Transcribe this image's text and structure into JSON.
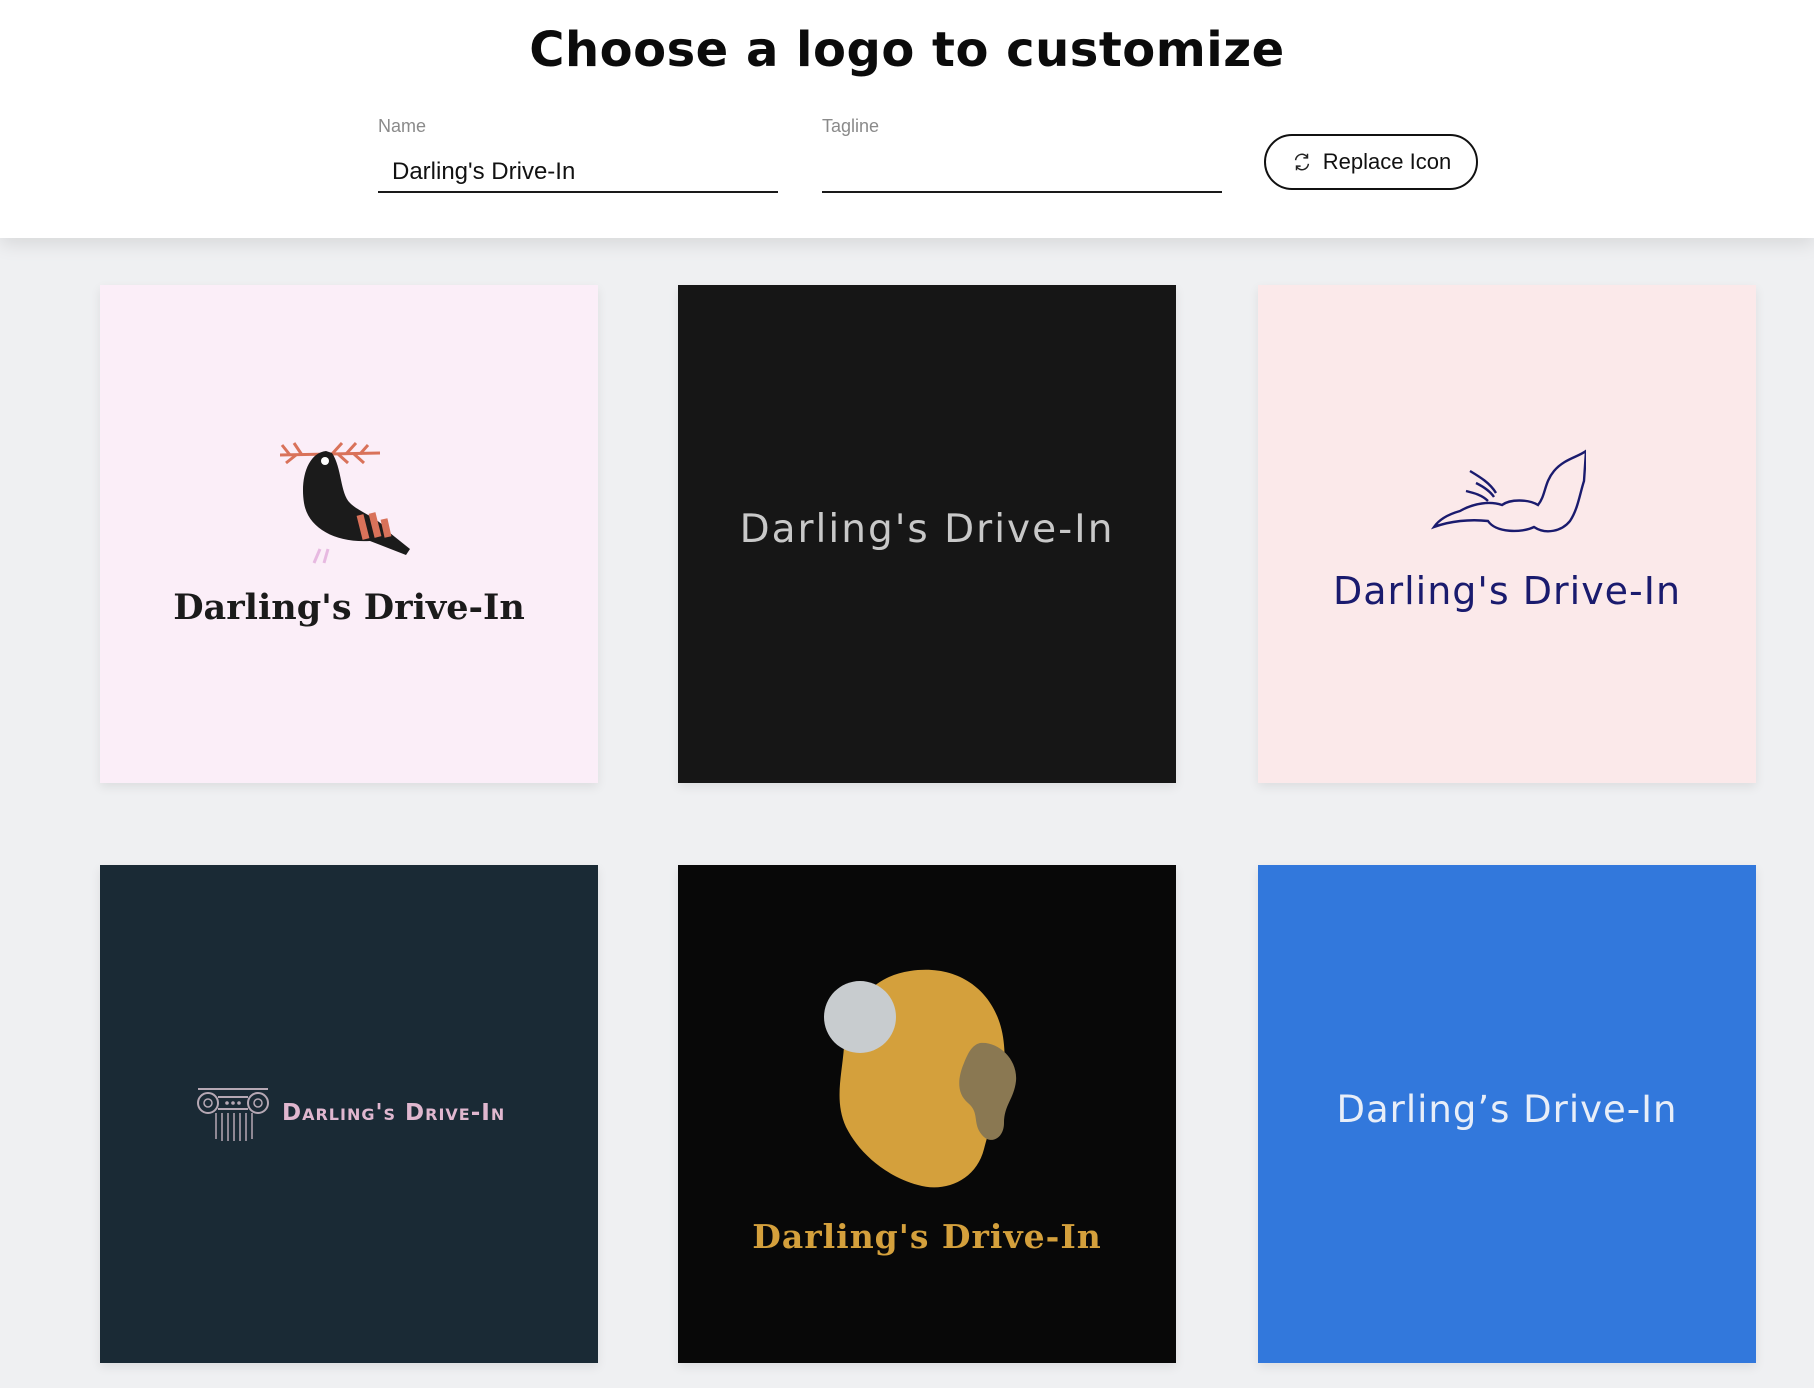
{
  "header": {
    "title": "Choose a logo to customize",
    "name_label": "Name",
    "name_value": "Darling's Drive-In",
    "tagline_label": "Tagline",
    "tagline_value": "",
    "replace_label": "Replace Icon",
    "replace_icon": "swap-arrows-icon"
  },
  "logos": [
    {
      "text": "Darling's Drive-In",
      "icon": "pigeon-with-olive-branch-icon",
      "bg": "#fbeef8",
      "color": "#1b1b1b"
    },
    {
      "text": "Darling's Drive-In",
      "icon": "none",
      "bg": "#161616",
      "color": "#c8c8c8"
    },
    {
      "text": "Darling's Drive-In",
      "icon": "flying-bird-outline-icon",
      "bg": "#fbe9ea",
      "color": "#1a1b6e"
    },
    {
      "text": "Darling's Drive-In",
      "icon": "ionic-column-icon",
      "bg": "#1a2a35",
      "color": "#e0b7cf"
    },
    {
      "text": "Darling's Drive-In",
      "icon": "abstract-blob-shapes-icon",
      "bg": "#080808",
      "color": "#d4a03c"
    },
    {
      "text": "Darling’s Drive-In",
      "icon": "none",
      "bg": "#3278dc",
      "color": "#e8eef8"
    }
  ]
}
